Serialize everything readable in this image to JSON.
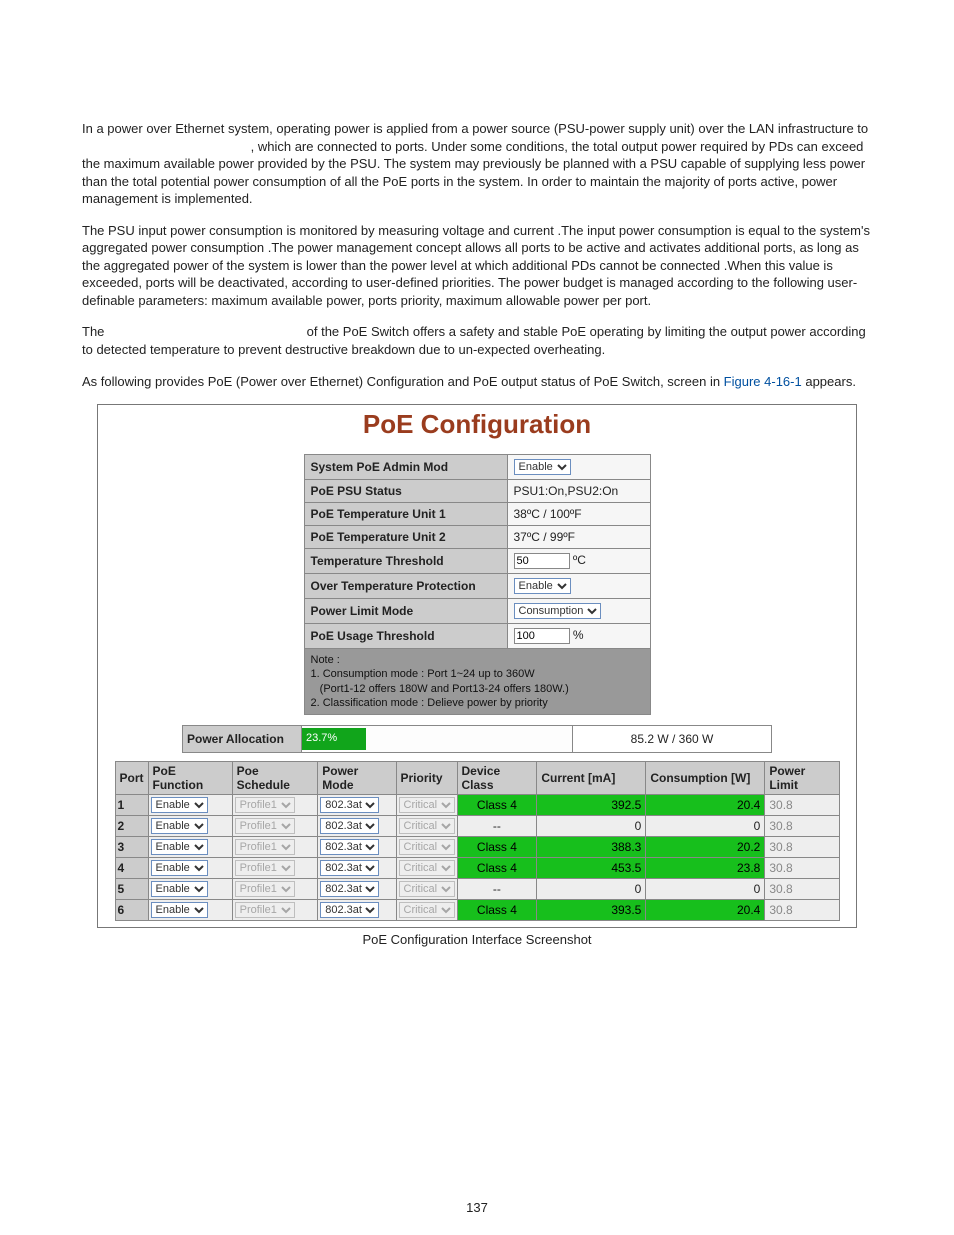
{
  "intro": {
    "p1_a": "In a power over Ethernet system, operating power is applied from a power source (PSU-power supply unit) over the LAN infrastructure to ",
    "p1_b": ", which are connected to ports. Under some conditions, the total output power required by PDs can exceed the maximum available power provided by the PSU. The system may previously be planned with a PSU capable of supplying less power than the total potential power consumption of all the PoE ports in the system. In order to maintain the majority of ports active, power management is implemented.",
    "p2": "The PSU input power consumption is monitored by measuring voltage and current .The input power consumption is equal to the system's aggregated power consumption .The power management concept allows all ports to be active and activates additional ports, as long as the aggregated power of the system is lower than the power level at which additional PDs cannot be connected .When this value is exceeded, ports will be deactivated, according to user-defined priorities. The power budget is managed according to the following user-definable parameters: maximum available power, ports priority, maximum allowable power per port.",
    "p3_a": "The ",
    "p3_b": " of the PoE Switch offers a safety and stable PoE operating by limiting the output power according to detected temperature to prevent destructive breakdown due to un-expected overheating.",
    "p4_a": "As following provides PoE (Power over Ethernet) Configuration and PoE output status of PoE Switch, screen in ",
    "p4_link": "Figure 4-16-1",
    "p4_b": " appears."
  },
  "figure": {
    "title": "PoE Configuration",
    "settings": {
      "admin_mode_label": "System PoE Admin Mod",
      "admin_mode_value": "Enable",
      "psu_status_label": "PoE PSU Status",
      "psu_status_value": "PSU1:On,PSU2:On",
      "temp1_label": "PoE Temperature Unit 1",
      "temp1_value": "38ºC / 100ºF",
      "temp2_label": "PoE Temperature Unit 2",
      "temp2_value": "37ºC / 99ºF",
      "temp_thresh_label": "Temperature Threshold",
      "temp_thresh_value": "50",
      "temp_thresh_unit": "ºC",
      "over_temp_label": "Over Temperature Protection",
      "over_temp_value": "Enable",
      "power_limit_label": "Power Limit Mode",
      "power_limit_value": "Consumption",
      "usage_thresh_label": "PoE Usage Threshold",
      "usage_thresh_value": "100",
      "usage_thresh_unit": "%",
      "note_title": "Note :",
      "note_l1": "1. Consumption mode : Port 1~24 up to 360W",
      "note_l2": "   (Port1-12 offers 180W and Port13-24 offers 180W.)",
      "note_l3": "2. Classification mode : Delieve power by priority"
    },
    "allocation": {
      "label": "Power Allocation",
      "percent": "23.7%",
      "bar_width": "23.7%",
      "reading": "85.2 W / 360 W"
    },
    "port_headers": {
      "port": "Port",
      "func": "PoE Function",
      "sched": "Poe Schedule",
      "mode": "Power Mode",
      "prio": "Priority",
      "class": "Device Class",
      "current": "Current [mA]",
      "cons": "Consumption [W]",
      "limit": "Power Limit"
    },
    "ports": [
      {
        "n": "1",
        "func": "Enable",
        "sched": "Profile1",
        "mode": "802.3at",
        "prio": "Critical",
        "class": "Class 4",
        "cur": "392.5",
        "cons": "20.4",
        "limit": "30.8",
        "active": true
      },
      {
        "n": "2",
        "func": "Enable",
        "sched": "Profile1",
        "mode": "802.3at",
        "prio": "Critical",
        "class": "--",
        "cur": "0",
        "cons": "0",
        "limit": "30.8",
        "active": false
      },
      {
        "n": "3",
        "func": "Enable",
        "sched": "Profile1",
        "mode": "802.3at",
        "prio": "Critical",
        "class": "Class 4",
        "cur": "388.3",
        "cons": "20.2",
        "limit": "30.8",
        "active": true
      },
      {
        "n": "4",
        "func": "Enable",
        "sched": "Profile1",
        "mode": "802.3at",
        "prio": "Critical",
        "class": "Class 4",
        "cur": "453.5",
        "cons": "23.8",
        "limit": "30.8",
        "active": true
      },
      {
        "n": "5",
        "func": "Enable",
        "sched": "Profile1",
        "mode": "802.3at",
        "prio": "Critical",
        "class": "--",
        "cur": "0",
        "cons": "0",
        "limit": "30.8",
        "active": false
      },
      {
        "n": "6",
        "func": "Enable",
        "sched": "Profile1",
        "mode": "802.3at",
        "prio": "Critical",
        "class": "Class 4",
        "cur": "393.5",
        "cons": "20.4",
        "limit": "30.8",
        "active": true
      }
    ],
    "caption": "PoE Configuration Interface Screenshot"
  },
  "page_number": "137"
}
